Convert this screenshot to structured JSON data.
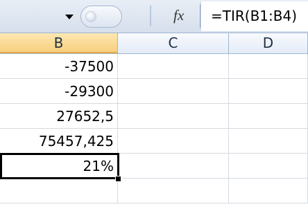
{
  "formula_bar": {
    "fx_label": "fx",
    "formula": "=TIR(B1:B4)"
  },
  "columns": [
    "B",
    "C",
    "D"
  ],
  "active_column": "B",
  "rows": [
    {
      "b": "-37500",
      "c": "",
      "d": ""
    },
    {
      "b": "-29300",
      "c": "",
      "d": ""
    },
    {
      "b": "27652,5",
      "c": "",
      "d": ""
    },
    {
      "b": "75457,425",
      "c": "",
      "d": ""
    },
    {
      "b": "21%",
      "c": "",
      "d": ""
    },
    {
      "b": "",
      "c": "",
      "d": ""
    }
  ],
  "selected_cell": "B5",
  "colors": {
    "active_header": "#f8cf7e",
    "gridline": "#d4d9e1",
    "header_border": "#9eb6ce"
  },
  "icons": [
    "namebox-dropdown-icon",
    "insert-function-icon"
  ]
}
